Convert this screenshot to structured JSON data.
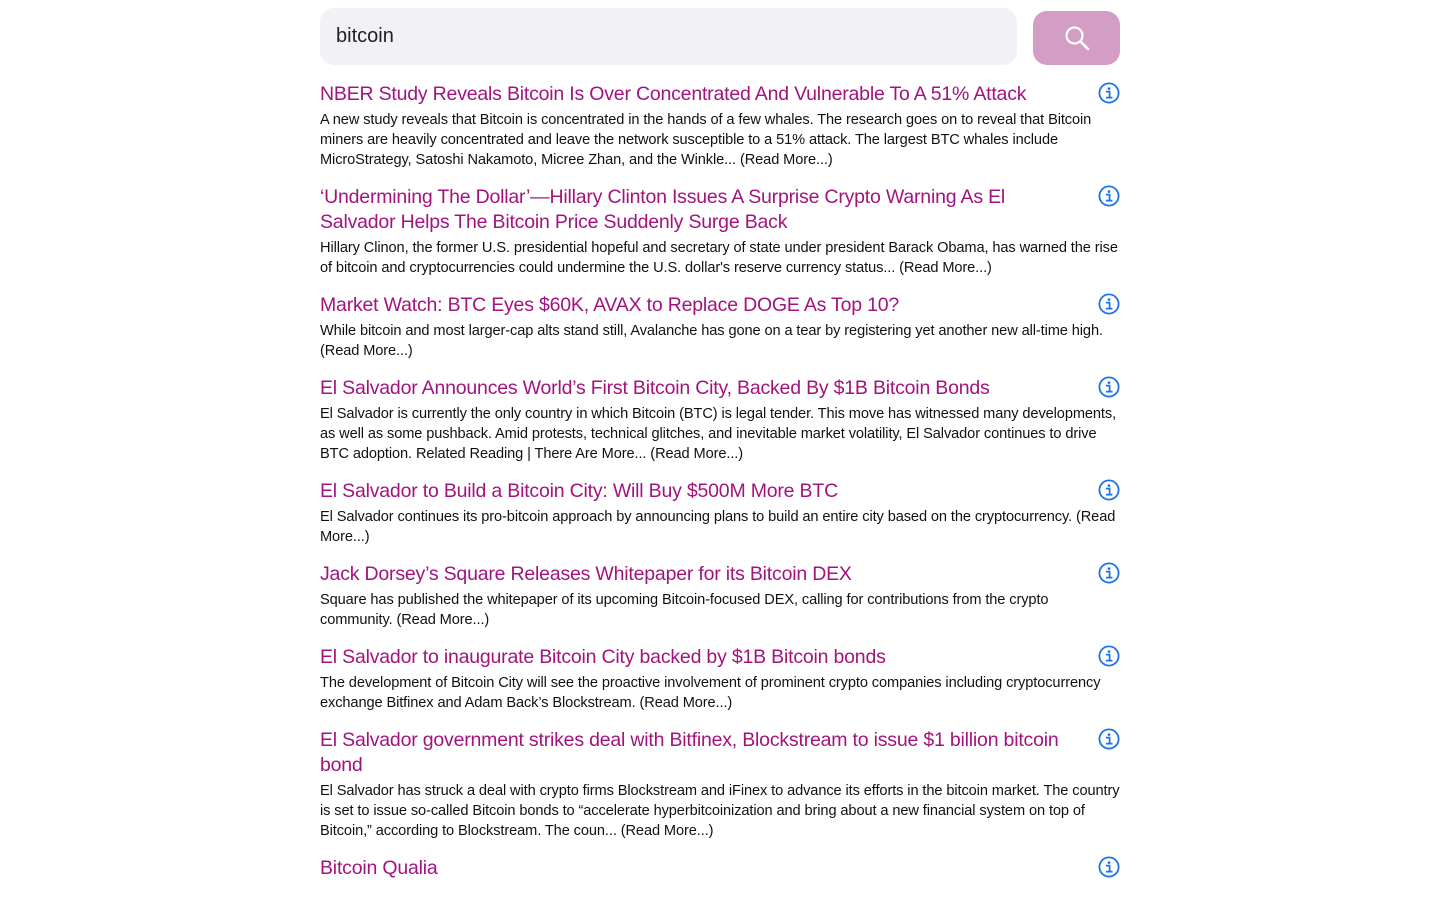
{
  "search": {
    "value": "bitcoin",
    "button_icon": "search-icon"
  },
  "colors": {
    "title": "#a3137e",
    "button": "#d39dc5",
    "info": "#1a73e8",
    "input_bg": "#f1f1f6"
  },
  "results": [
    {
      "title": "NBER Study Reveals Bitcoin Is Over Concentrated And Vulnerable To A 51% Attack",
      "snippet": "A new study reveals that Bitcoin is concentrated in the hands of a few whales. The research goes on to reveal that Bitcoin miners are heavily concentrated and leave the network susceptible to a 51% attack. The largest BTC whales include MicroStrategy, Satoshi Nakamoto, Micree Zhan, and the Winkle... (Read More...)"
    },
    {
      "title": "‘Undermining The Dollar’—Hillary Clinton Issues A Surprise Crypto Warning As El Salvador Helps The Bitcoin Price Suddenly Surge Back",
      "snippet": "Hillary Clinon, the former U.S. presidential hopeful and secretary of state under president Barack Obama, has warned the rise of bitcoin and cryptocurrencies could undermine the U.S. dollar's reserve currency status... (Read More...)"
    },
    {
      "title": "Market Watch: BTC Eyes $60K, AVAX to Replace DOGE As Top 10?",
      "snippet": "While bitcoin and most larger-cap alts stand still, Avalanche has gone on a tear by registering yet another new all-time high. (Read More...)"
    },
    {
      "title": "El Salvador Announces World’s First Bitcoin City, Backed By $1B Bitcoin Bonds",
      "snippet": "El Salvador is currently the only country in which Bitcoin (BTC) is legal tender. This move has witnessed many developments, as well as some pushback. Amid protests, technical glitches, and inevitable market volatility, El Salvador continues to drive BTC adoption. Related Reading | There Are More... (Read More...)"
    },
    {
      "title": "El Salvador to Build a Bitcoin City: Will Buy $500M More BTC",
      "snippet": "El Salvador continues its pro-bitcoin approach by announcing plans to build an entire city based on the cryptocurrency. (Read More...)"
    },
    {
      "title": "Jack Dorsey’s Square Releases Whitepaper for its Bitcoin DEX",
      "snippet": "Square has published the whitepaper of its upcoming Bitcoin-focused DEX, calling for contributions from the crypto community. (Read More...)"
    },
    {
      "title": "El Salvador to inaugurate Bitcoin City backed by $1B Bitcoin bonds",
      "snippet": "The development of Bitcoin City will see the proactive involvement of prominent crypto companies including cryptocurrency exchange Bitfinex and Adam Back’s Blockstream. (Read More...)"
    },
    {
      "title": "El Salvador government strikes deal with Bitfinex, Blockstream to issue $1 billion bitcoin bond",
      "snippet": "El Salvador has struck a deal with crypto firms Blockstream and iFinex to advance its efforts in the bitcoin market. The country is set to issue so-called Bitcoin bonds to “accelerate hyperbitcoinization and bring about a new financial system on top of Bitcoin,” according to Blockstream. The coun... (Read More...)"
    },
    {
      "title": "Bitcoin Qualia",
      "snippet": ""
    }
  ]
}
